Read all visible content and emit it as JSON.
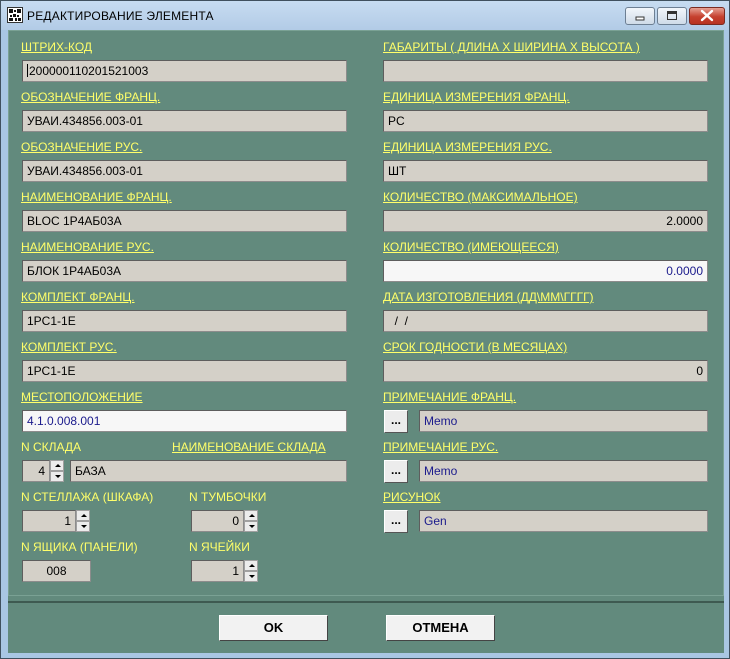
{
  "window": {
    "title": "РЕДАКТИРОВАНИЕ ЭЛЕМЕНТА",
    "accent_color": "#628a7d",
    "label_color": "#ffff6a"
  },
  "left": {
    "barcode": {
      "label": "ШТРИХ-КОД",
      "value": "200000110201521003"
    },
    "designation_fr": {
      "label": "ОБОЗНАЧЕНИЕ  ФРАНЦ.",
      "value": "УВАИ.434856.003-01"
    },
    "designation_ru": {
      "label": "ОБОЗНАЧЕНИЕ  РУС.",
      "value": "УВАИ.434856.003-01"
    },
    "name_fr": {
      "label": "НАИМЕНОВАНИЕ  ФРАНЦ.",
      "value": "BLOC 1P4АБ03А"
    },
    "name_ru": {
      "label": "НАИМЕНОВАНИЕ  РУС.",
      "value": "БЛОК 1Р4АБ03А"
    },
    "set_fr": {
      "label": "КОМПЛЕКТ  ФРАНЦ.",
      "value": "1PC1-1E"
    },
    "set_ru": {
      "label": "КОМПЛЕКТ  РУС.",
      "value": "1РС1-1Е"
    },
    "location": {
      "label": "МЕСТОПОЛОЖЕНИЕ",
      "value": "4.1.0.008.001"
    },
    "warehouse_no": {
      "label": "N  СКЛАДА",
      "value": "4"
    },
    "warehouse_name": {
      "label": "НАИМЕНОВАНИЕ СКЛАДА",
      "value": "БАЗА"
    },
    "rack_no": {
      "label": "N  СТЕЛЛАЖА (ШКАФА)",
      "value": "1"
    },
    "cabinet_no": {
      "label": "N  ТУМБОЧКИ",
      "value": "0"
    },
    "box_no": {
      "label": "N  ЯЩИКА (ПАНЕЛИ)",
      "value": "008"
    },
    "cell_no": {
      "label": "N  ЯЧЕЙКИ",
      "value": "1"
    }
  },
  "right": {
    "dimensions": {
      "label": "ГАБАРИТЫ ( ДЛИНА Х ШИРИНА Х ВЫСОТА )",
      "value": ""
    },
    "unit_fr": {
      "label": "ЕДИНИЦА ИЗМЕРЕНИЯ  ФРАНЦ.",
      "value": "PC"
    },
    "unit_ru": {
      "label": "ЕДИНИЦА ИЗМЕРЕНИЯ  РУС.",
      "value": "ШТ"
    },
    "qty_max": {
      "label": "КОЛИЧЕСТВО (МАКСИМАЛЬНОЕ)",
      "value": "2.0000"
    },
    "qty_have": {
      "label": "КОЛИЧЕСТВО (ИМЕЮЩЕЕСЯ)",
      "value": "0.0000"
    },
    "mfg_date": {
      "label": "ДАТА ИЗГОТОВЛЕНИЯ  (ДД\\ММ\\ГГГГ)",
      "value": "  /  /"
    },
    "shelf_life": {
      "label": "СРОК ГОДНОСТИ  (В МЕСЯЦАХ)",
      "value": "0"
    },
    "note_fr": {
      "label": "ПРИМЕЧАНИЕ  ФРАНЦ.",
      "button": "...",
      "value": "Memo"
    },
    "note_ru": {
      "label": "ПРИМЕЧАНИЕ  РУС.",
      "button": "...",
      "value": "Memo"
    },
    "picture": {
      "label": "РИСУНОК",
      "button": "...",
      "value": "Gen"
    }
  },
  "buttons": {
    "ok": "OK",
    "cancel": "ОТМЕНА"
  }
}
